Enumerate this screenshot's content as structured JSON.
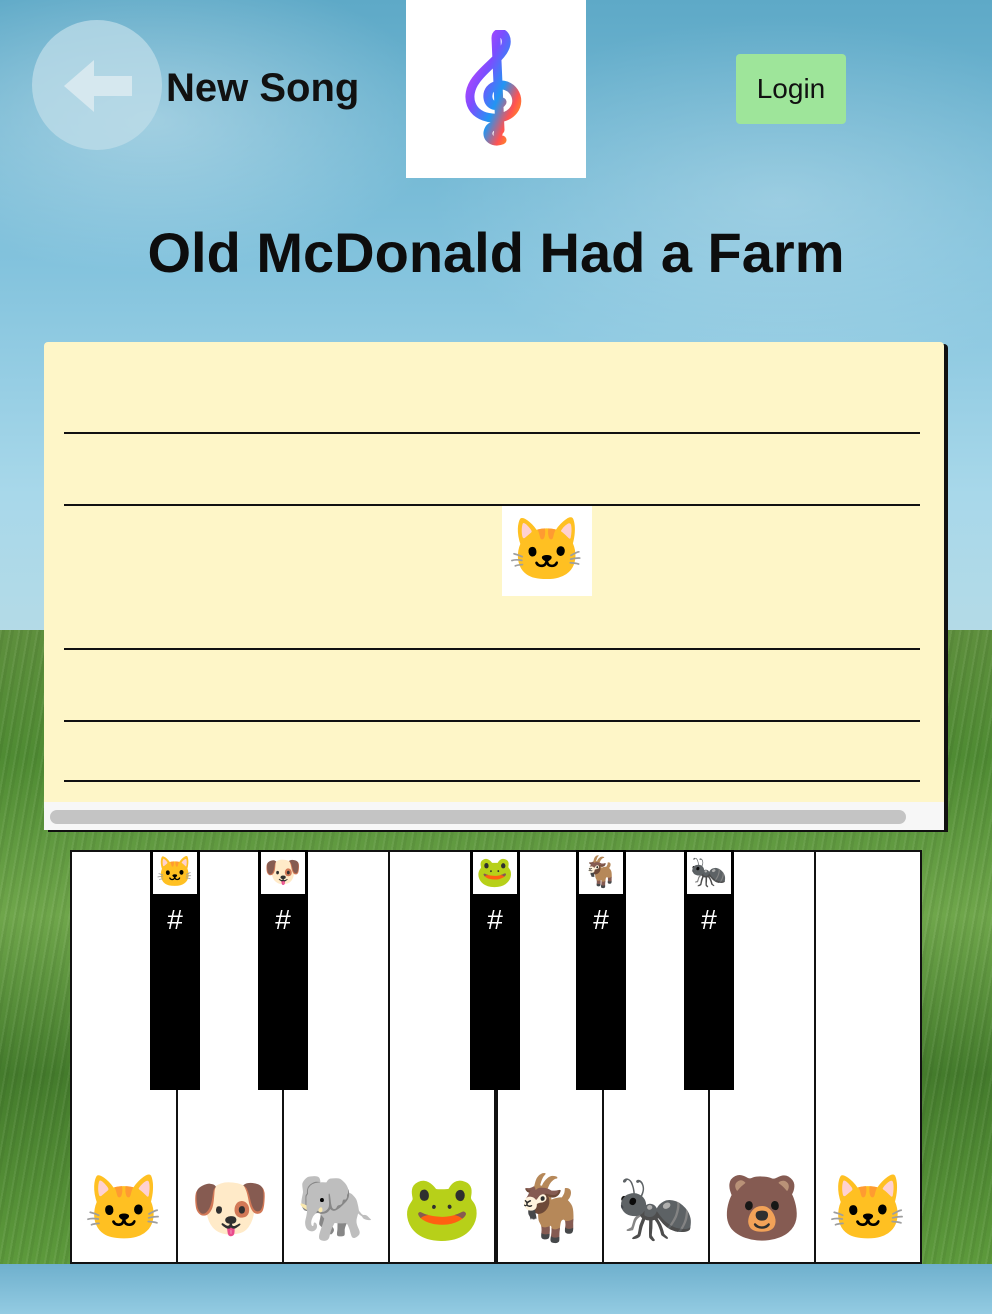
{
  "header": {
    "page_title": "New Song",
    "login_label": "Login"
  },
  "song": {
    "title": "Old McDonald Had a Farm",
    "notes": [
      {
        "emoji": "🐱"
      }
    ]
  },
  "piano": {
    "white_keys": [
      {
        "emoji": "🐱"
      },
      {
        "emoji": "🐶"
      },
      {
        "emoji": "🐘"
      },
      {
        "emoji": "🐸"
      },
      {
        "emoji": "🐐"
      },
      {
        "emoji": "🐜"
      },
      {
        "emoji": "🐻"
      },
      {
        "emoji": "🐱"
      }
    ],
    "black_keys": [
      {
        "emoji": "🐱",
        "label": "#"
      },
      {
        "emoji": "🐶",
        "label": "#"
      },
      {
        "emoji": "🐸",
        "label": "#"
      },
      {
        "emoji": "🐐",
        "label": "#"
      },
      {
        "emoji": "🐜",
        "label": "#"
      }
    ]
  },
  "colors": {
    "login_bg": "#9ee59a",
    "staff_bg": "#fef6c8"
  }
}
